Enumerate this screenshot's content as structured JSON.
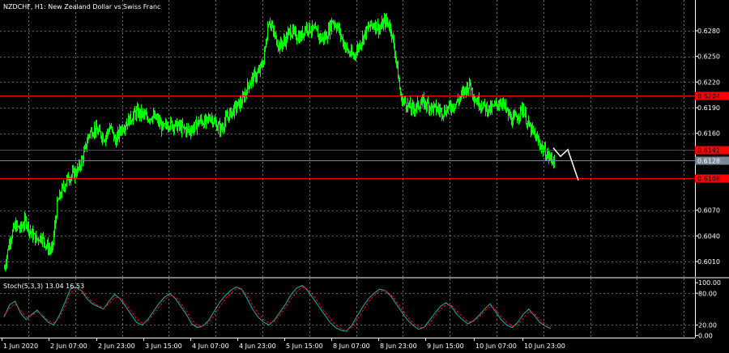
{
  "window": {
    "title": "NZDCHF, H1:  New Zealand Dollar vs Swiss Franc"
  },
  "colors": {
    "background": "#000000",
    "grid": "#c0c0c0",
    "candle_up": "#00ff00",
    "candle_down": "#00ff00",
    "level_line": "#ff0000",
    "bid_line": "#778899",
    "forecast_line": "#ffffff",
    "stoch_main": "#20b2aa",
    "stoch_signal": "#ff0000"
  },
  "chart_data": [
    {
      "type": "candlestick",
      "title": "NZDCHF, H1:  New Zealand Dollar vs Swiss Franc",
      "symbol": "NZDCHF",
      "timeframe": "H1",
      "ylim": [
        0.5992,
        0.6316
      ],
      "yticks": [
        "0.6280",
        "0.6250",
        "0.6220",
        "0.6190",
        "0.6160",
        "0.6070",
        "0.6040",
        "0.6010"
      ],
      "x_time_labels": [
        "1 Jun 2020",
        "2 Jun 07:00",
        "2 Jun 23:00",
        "3 Jun 15:00",
        "4 Jun 07:00",
        "4 Jun 23:00",
        "5 Jun 15:00",
        "8 Jun 07:00",
        "8 Jun 23:00",
        "9 Jun 15:00",
        "10 Jun 07:00",
        "10 Jun 23:00"
      ],
      "close_path": [
        0.6002,
        0.6035,
        0.6052,
        0.6048,
        0.6058,
        0.6044,
        0.6036,
        0.604,
        0.6028,
        0.6022,
        0.6078,
        0.6095,
        0.6108,
        0.6112,
        0.6118,
        0.6135,
        0.616,
        0.6165,
        0.616,
        0.6155,
        0.6168,
        0.615,
        0.6165,
        0.6172,
        0.6178,
        0.6185,
        0.6182,
        0.6178,
        0.618,
        0.6175,
        0.6165,
        0.6172,
        0.617,
        0.6168,
        0.6165,
        0.6163,
        0.6168,
        0.6175,
        0.6172,
        0.618,
        0.617,
        0.6165,
        0.6178,
        0.6185,
        0.6192,
        0.6198,
        0.6215,
        0.6225,
        0.623,
        0.6245,
        0.6295,
        0.6275,
        0.6262,
        0.6268,
        0.628,
        0.6275,
        0.6272,
        0.6285,
        0.6282,
        0.6278,
        0.627,
        0.6275,
        0.6292,
        0.6285,
        0.6268,
        0.6255,
        0.625,
        0.6262,
        0.6275,
        0.6285,
        0.6288,
        0.6282,
        0.6292,
        0.6285,
        0.625,
        0.62,
        0.6195,
        0.6188,
        0.6192,
        0.6196,
        0.6194,
        0.619,
        0.6188,
        0.6185,
        0.619,
        0.6193,
        0.62,
        0.621,
        0.6218,
        0.62,
        0.6195,
        0.619,
        0.6188,
        0.6193,
        0.6198,
        0.6185,
        0.6175,
        0.618,
        0.619,
        0.617,
        0.616,
        0.615,
        0.614,
        0.6132,
        0.6128
      ],
      "levels": [
        {
          "price": 0.6204,
          "label": "0.6204"
        },
        {
          "price": 0.6141,
          "label": "0.6141"
        },
        {
          "price": 0.6108,
          "label": "0.6108"
        }
      ],
      "bid": {
        "price": 0.6128,
        "label": "0.6128"
      },
      "forecast": [
        0.6143,
        0.6133,
        0.6141,
        0.6105
      ]
    },
    {
      "type": "line",
      "indicator": "Stoch(5,3,3)",
      "label": "Stoch(5,3,3) 13.04 16.53",
      "ylim": [
        -4,
        108
      ],
      "yticks": [
        "100.00",
        "80.00",
        "20.00",
        "0.00"
      ],
      "levels": [
        20,
        80
      ],
      "series": [
        {
          "name": "main",
          "values": [
            35,
            58,
            65,
            42,
            30,
            40,
            48,
            36,
            25,
            20,
            38,
            62,
            88,
            92,
            85,
            70,
            60,
            55,
            50,
            65,
            78,
            70,
            55,
            40,
            25,
            20,
            30,
            45,
            60,
            72,
            80,
            70,
            55,
            40,
            22,
            15,
            18,
            28,
            45,
            62,
            75,
            85,
            92,
            88,
            70,
            50,
            35,
            25,
            20,
            30,
            45,
            60,
            78,
            90,
            95,
            85,
            70,
            55,
            40,
            25,
            15,
            10,
            8,
            20,
            38,
            55,
            70,
            80,
            88,
            85,
            75,
            60,
            45,
            30,
            20,
            12,
            15,
            28,
            42,
            55,
            62,
            55,
            40,
            30,
            22,
            28,
            38,
            50,
            60,
            45,
            30,
            20,
            15,
            25,
            40,
            50,
            38,
            25,
            18,
            13
          ]
        },
        {
          "name": "signal",
          "values": [
            38,
            52,
            60,
            48,
            35,
            38,
            45,
            38,
            28,
            24,
            33,
            55,
            80,
            88,
            86,
            74,
            63,
            57,
            52,
            60,
            72,
            71,
            60,
            46,
            31,
            24,
            27,
            40,
            54,
            67,
            76,
            73,
            60,
            46,
            29,
            20,
            18,
            24,
            38,
            54,
            69,
            80,
            88,
            88,
            76,
            58,
            42,
            30,
            23,
            27,
            40,
            54,
            70,
            84,
            92,
            88,
            76,
            61,
            46,
            32,
            20,
            13,
            10,
            16,
            31,
            48,
            64,
            76,
            84,
            85,
            78,
            65,
            50,
            36,
            24,
            16,
            15,
            23,
            36,
            50,
            58,
            57,
            46,
            35,
            26,
            27,
            35,
            46,
            55,
            49,
            36,
            25,
            18,
            21,
            33,
            45,
            41,
            30,
            22,
            16.53
          ]
        }
      ]
    }
  ]
}
